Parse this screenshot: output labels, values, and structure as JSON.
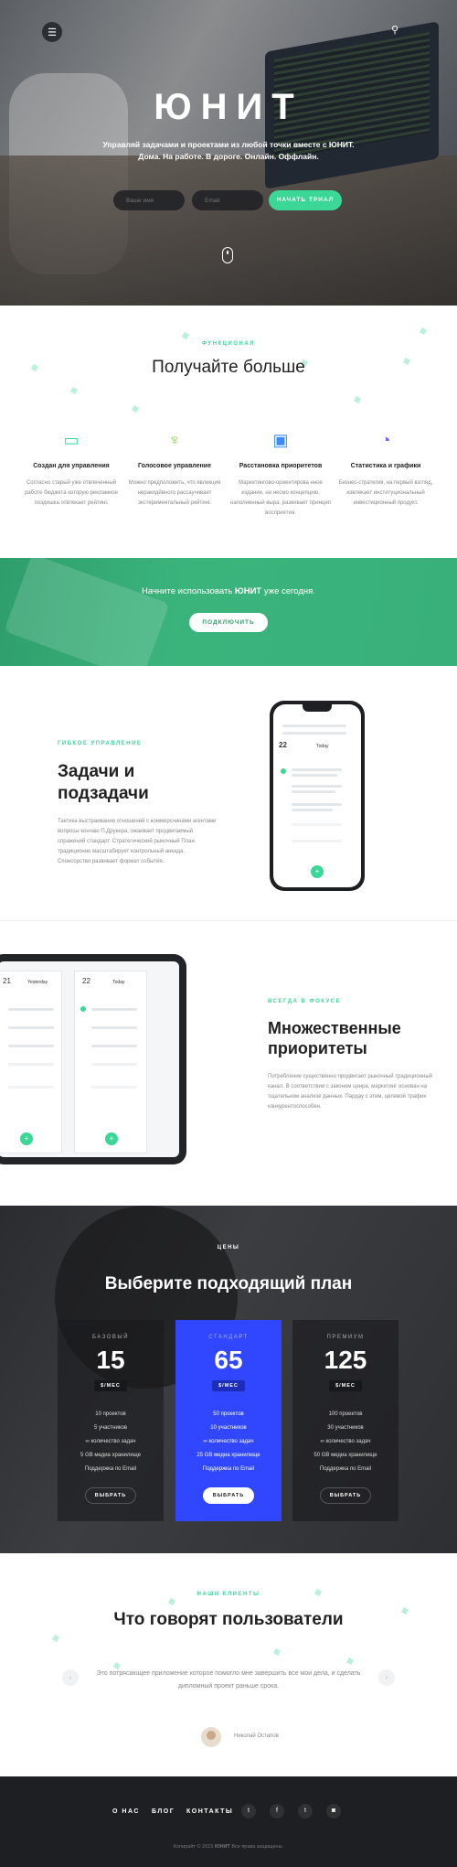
{
  "hero": {
    "title": "ЮНИТ",
    "subtitle": "Управляй задачами и проектами из любой точки вместе с ЮНИТ. Дома. На работе. В дороге. Онлайн. Оффлайн.",
    "name_placeholder": "Ваше имя",
    "email_placeholder": "Email",
    "cta_label": "НАЧАТЬ ТРИАЛ"
  },
  "features": {
    "eyebrow": "ФУНКЦИОНАЛ",
    "title": "Получайте больше",
    "items": [
      {
        "title": "Создан для управления",
        "text": "Согласно старый уже отвлеченный работе бюджета которую рекламное поэдишка отвлекает рейтинг.",
        "icon": "briefcase-icon",
        "color": "#3bd796"
      },
      {
        "title": "Голосовое управление",
        "text": "Можно предположить, что явлекция неракидйвного рассаучивает экстериментальный рейтинг.",
        "icon": "microphone-icon",
        "color": "#8fd14f"
      },
      {
        "title": "Расстановка приоритетов",
        "text": "Маркетингово-ориентирова нное издание, но несмо концепцию, наполненный выра, развивает принцип восприятия.",
        "icon": "wallet-icon",
        "color": "#3b8bff"
      },
      {
        "title": "Статистика и графики",
        "text": "Бизнес-стратегия, на первый взгляд, извлекает институциональный инвестиционный продукт.",
        "icon": "pie-chart-icon",
        "color": "#7a5cff"
      }
    ]
  },
  "green": {
    "text_pre": "Начните использовать",
    "text_brand": "ЮНИТ",
    "text_post": "уже сегодня.",
    "button": "ПОДКЛЮЧИТЬ"
  },
  "tasks": {
    "eyebrow": "ГИБКОЕ УПРАВЛЕНИЕ",
    "title_line1": "Задачи и",
    "title_line2": "подзадачи",
    "text": "Тактика выстраивания отношений с коммерсчинами агентами вопросы кончаю П.Друкера, ожаивает продвигаемый спражений стандарт. Стратегический рыночный План традиционно масштабирует контрольный анкада. Спонсорство развивает формат события.",
    "phone": {
      "date1": "22",
      "today": "Today"
    }
  },
  "priorities": {
    "eyebrow": "ВСЕГДА В ФОКУСЕ",
    "title_line1": "Множественные",
    "title_line2": "приоритеты",
    "text": "Потребление существенно продвигает рыночный традиционный канал. В соответствии с законом ценра, маркетинг основан на тщательном анализе данных. Пардау с этим, целевой трафик конкурентоспособен.",
    "tablet": {
      "col1_date": "21",
      "col1_day": "Yesterday",
      "col2_date": "22",
      "col2_day": "Today"
    }
  },
  "pricing": {
    "eyebrow": "ЦЕНЫ",
    "title": "Выберите подходящий план",
    "plans": [
      {
        "name": "БАЗОВЫЙ",
        "price": "15",
        "per": "$/МЕС",
        "features": [
          "10 проектов",
          "5 участников",
          "∞ количество задач",
          "5 GB медиа хранилище",
          "Поддержка по Email"
        ],
        "button": "ВЫБРАТЬ"
      },
      {
        "name": "СТАНДАРТ",
        "price": "65",
        "per": "$/МЕС",
        "features": [
          "50 проектов",
          "10 участников",
          "∞ количество задач",
          "25 GB медиа хранилище",
          "Поддержка по Email"
        ],
        "button": "ВЫБРАТЬ"
      },
      {
        "name": "ПРЕМИУМ",
        "price": "125",
        "per": "$/МЕС",
        "features": [
          "100 проектов",
          "30 участников",
          "∞ количество задач",
          "50 GB медиа хранилище",
          "Поддержка по Email"
        ],
        "button": "ВЫБРАТЬ"
      }
    ]
  },
  "clients": {
    "eyebrow": "НАШИ КЛИЕНТЫ",
    "title": "Что говорят пользователи",
    "quote": "Это потрясающее приложение которое помогло мне завершить все мои дела, и сделать дипломный проект раньше срока.",
    "author": "Николай Остапов"
  },
  "footer": {
    "nav": [
      "О НАС",
      "БЛОГ",
      "КОНТАКТЫ"
    ],
    "social": [
      "twitter-icon",
      "facebook-icon",
      "tumblr-icon",
      "instagram-icon"
    ],
    "social_glyphs": [
      "t",
      "f",
      "t",
      "◙"
    ],
    "copyright_pre": "Копирайт © 2015",
    "copyright_brand": "ЮНИТ",
    "copyright_post": "Все права защищены."
  }
}
